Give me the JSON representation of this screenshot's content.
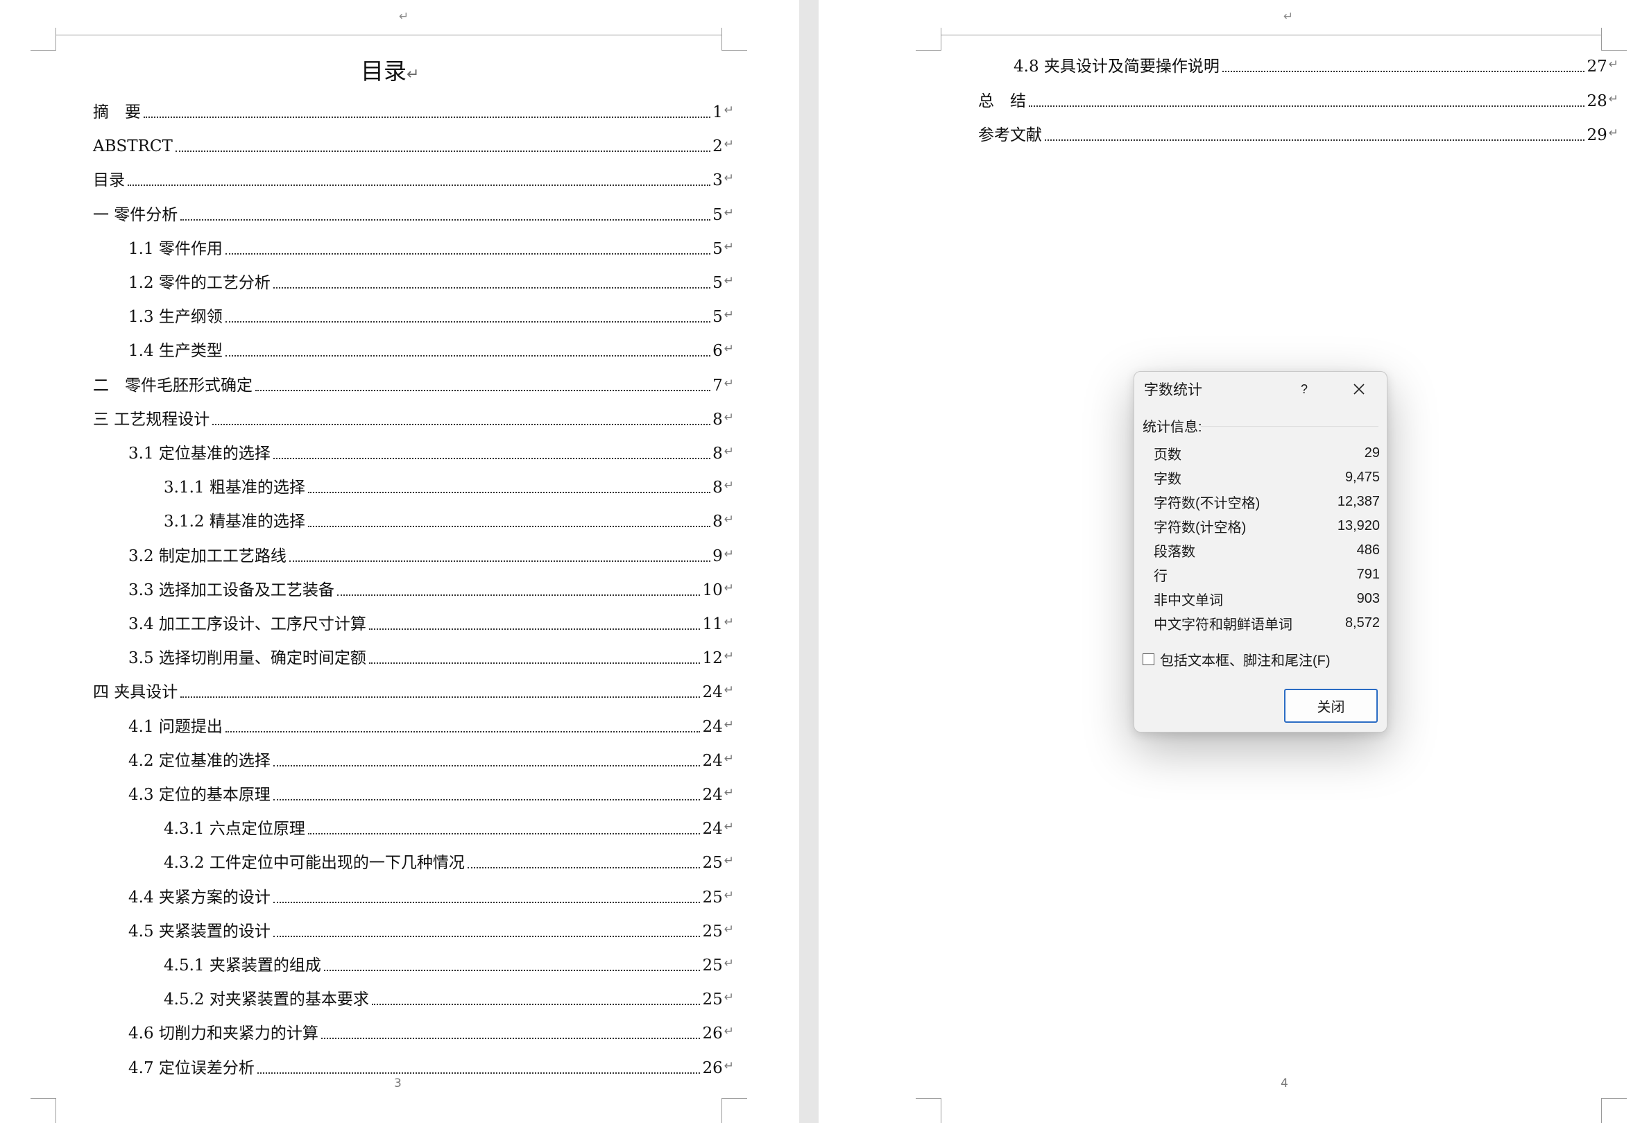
{
  "document": {
    "toc_title": "目录",
    "paragraph_mark": "↵",
    "left_page": {
      "footer": "3",
      "entries": [
        {
          "text": "摘　要",
          "page": "1"
        },
        {
          "text": "ABSTRCT",
          "page": "2"
        },
        {
          "text": "目录",
          "page": "3"
        },
        {
          "text": "一 零件分析",
          "page": "5"
        },
        {
          "text": "1.1 零件作用",
          "page": "5"
        },
        {
          "text": "1.2 零件的工艺分析",
          "page": "5"
        },
        {
          "text": "1.3 生产纲领",
          "page": "5"
        },
        {
          "text": "1.4 生产类型",
          "page": "6"
        },
        {
          "text": "二　零件毛胚形式确定",
          "page": "7"
        },
        {
          "text": "三 工艺规程设计",
          "page": "8"
        },
        {
          "text": "3.1 定位基准的选择",
          "page": "8"
        },
        {
          "text": "3.1.1 粗基准的选择",
          "page": "8"
        },
        {
          "text": "3.1.2 精基准的选择",
          "page": "8"
        },
        {
          "text": "3.2 制定加工工艺路线",
          "page": "9"
        },
        {
          "text": "3.3 选择加工设备及工艺装备",
          "page": "10"
        },
        {
          "text": "3.4 加工工序设计、工序尺寸计算",
          "page": "11"
        },
        {
          "text": "3.5 选择切削用量、确定时间定额",
          "page": "12"
        },
        {
          "text": "四 夹具设计",
          "page": "24"
        },
        {
          "text": "4.1 问题提出",
          "page": "24"
        },
        {
          "text": "4.2 定位基准的选择",
          "page": "24"
        },
        {
          "text": "4.3 定位的基本原理",
          "page": "24"
        },
        {
          "text": "4.3.1 六点定位原理",
          "page": "24"
        },
        {
          "text": "4.3.2 工件定位中可能出现的一下几种情况",
          "page": "25"
        },
        {
          "text": "4.4 夹紧方案的设计",
          "page": "25"
        },
        {
          "text": "4.5 夹紧装置的设计",
          "page": "25"
        },
        {
          "text": "4.5.1 夹紧装置的组成",
          "page": "25"
        },
        {
          "text": "4.5.2 对夹紧装置的基本要求",
          "page": "25"
        },
        {
          "text": "4.6 切削力和夹紧力的计算",
          "page": "26"
        },
        {
          "text": "4.7 定位误差分析",
          "page": "26"
        }
      ]
    },
    "right_page": {
      "footer": "4",
      "entries": [
        {
          "text": "4.8 夹具设计及简要操作说明",
          "page": "27"
        },
        {
          "text": "总　结",
          "page": "28"
        },
        {
          "text": "参考文献",
          "page": "29"
        }
      ]
    }
  },
  "dialog": {
    "title": "字数统计",
    "help": "?",
    "section": "统计信息:",
    "stats": [
      {
        "label": "页数",
        "value": "29"
      },
      {
        "label": "字数",
        "value": "9,475"
      },
      {
        "label": "字符数(不计空格)",
        "value": "12,387"
      },
      {
        "label": "字符数(计空格)",
        "value": "13,920"
      },
      {
        "label": "段落数",
        "value": "486"
      },
      {
        "label": "行",
        "value": "791"
      },
      {
        "label": "非中文单词",
        "value": "903"
      },
      {
        "label": "中文字符和朝鲜语单词",
        "value": "8,572"
      }
    ],
    "checkbox_label": "包括文本框、脚注和尾注(F)",
    "checkbox_checked": false,
    "close_button": "关闭"
  }
}
